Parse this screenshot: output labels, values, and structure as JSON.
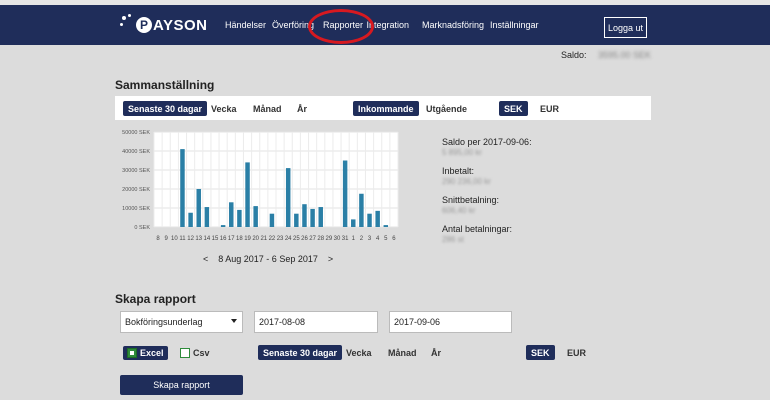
{
  "nav": {
    "brand": "PAYSON",
    "brand_initial": "P",
    "items": [
      "Händelser",
      "Överföring",
      "Rapporter",
      "Integration",
      "Marknadsföring",
      "Inställningar"
    ],
    "logout": "Logga ut"
  },
  "balance": {
    "label": "Saldo:",
    "value": "3595.00 SEK"
  },
  "summary": {
    "title": "Sammanställning",
    "periods": [
      "Senaste 30 dagar",
      "Vecka",
      "Månad",
      "År"
    ],
    "active_period": "Senaste 30 dagar",
    "directions": [
      "Inkommande",
      "Utgående"
    ],
    "active_direction": "Inkommande",
    "currencies": [
      "SEK",
      "EUR"
    ],
    "active_currency": "SEK",
    "range_prev": "<",
    "range_label": "8 Aug 2017 - 6 Sep 2017",
    "range_next": ">"
  },
  "stats": [
    {
      "label": "Saldo per 2017-09-06:",
      "value": "5 895,00 kr"
    },
    {
      "label": "Inbetalt:",
      "value": "290 236,00 kr"
    },
    {
      "label": "Snittbetalning:",
      "value": "606,40 kr"
    },
    {
      "label": "Antal betalningar:",
      "value": "286 st"
    }
  ],
  "report": {
    "title": "Skapa rapport",
    "type_value": "Bokföringsunderlag",
    "from_date": "2017-08-08",
    "to_date": "2017-09-06",
    "excel_label": "Excel",
    "csv_label": "Csv",
    "periods": [
      "Senaste 30 dagar",
      "Vecka",
      "Månad",
      "År"
    ],
    "active_period": "Senaste 30 dagar",
    "currencies": [
      "SEK",
      "EUR"
    ],
    "active_currency": "SEK",
    "create_label": "Skapa rapport"
  },
  "colors": {
    "navy": "#1f2d5a",
    "bar": "#2a7fa6",
    "ring": "#d71920"
  },
  "chart_data": {
    "type": "bar",
    "categories": [
      "8",
      "9",
      "10",
      "11",
      "12",
      "13",
      "14",
      "15",
      "16",
      "17",
      "18",
      "19",
      "20",
      "21",
      "22",
      "23",
      "24",
      "25",
      "26",
      "27",
      "28",
      "29",
      "30",
      "31",
      "1",
      "2",
      "3",
      "4",
      "5",
      "6"
    ],
    "values": [
      0,
      0,
      0,
      41000,
      7500,
      20000,
      10500,
      0,
      1000,
      13000,
      9000,
      34000,
      11000,
      0,
      7000,
      0,
      31000,
      7000,
      12000,
      9500,
      10500,
      0,
      0,
      35000,
      4000,
      17500,
      7000,
      8500,
      1000,
      0
    ],
    "ylim": [
      0,
      50000
    ],
    "yticks": [
      "0 SEK",
      "10000 SEK",
      "20000 SEK",
      "30000 SEK",
      "40000 SEK",
      "50000 SEK"
    ],
    "grid": true
  }
}
